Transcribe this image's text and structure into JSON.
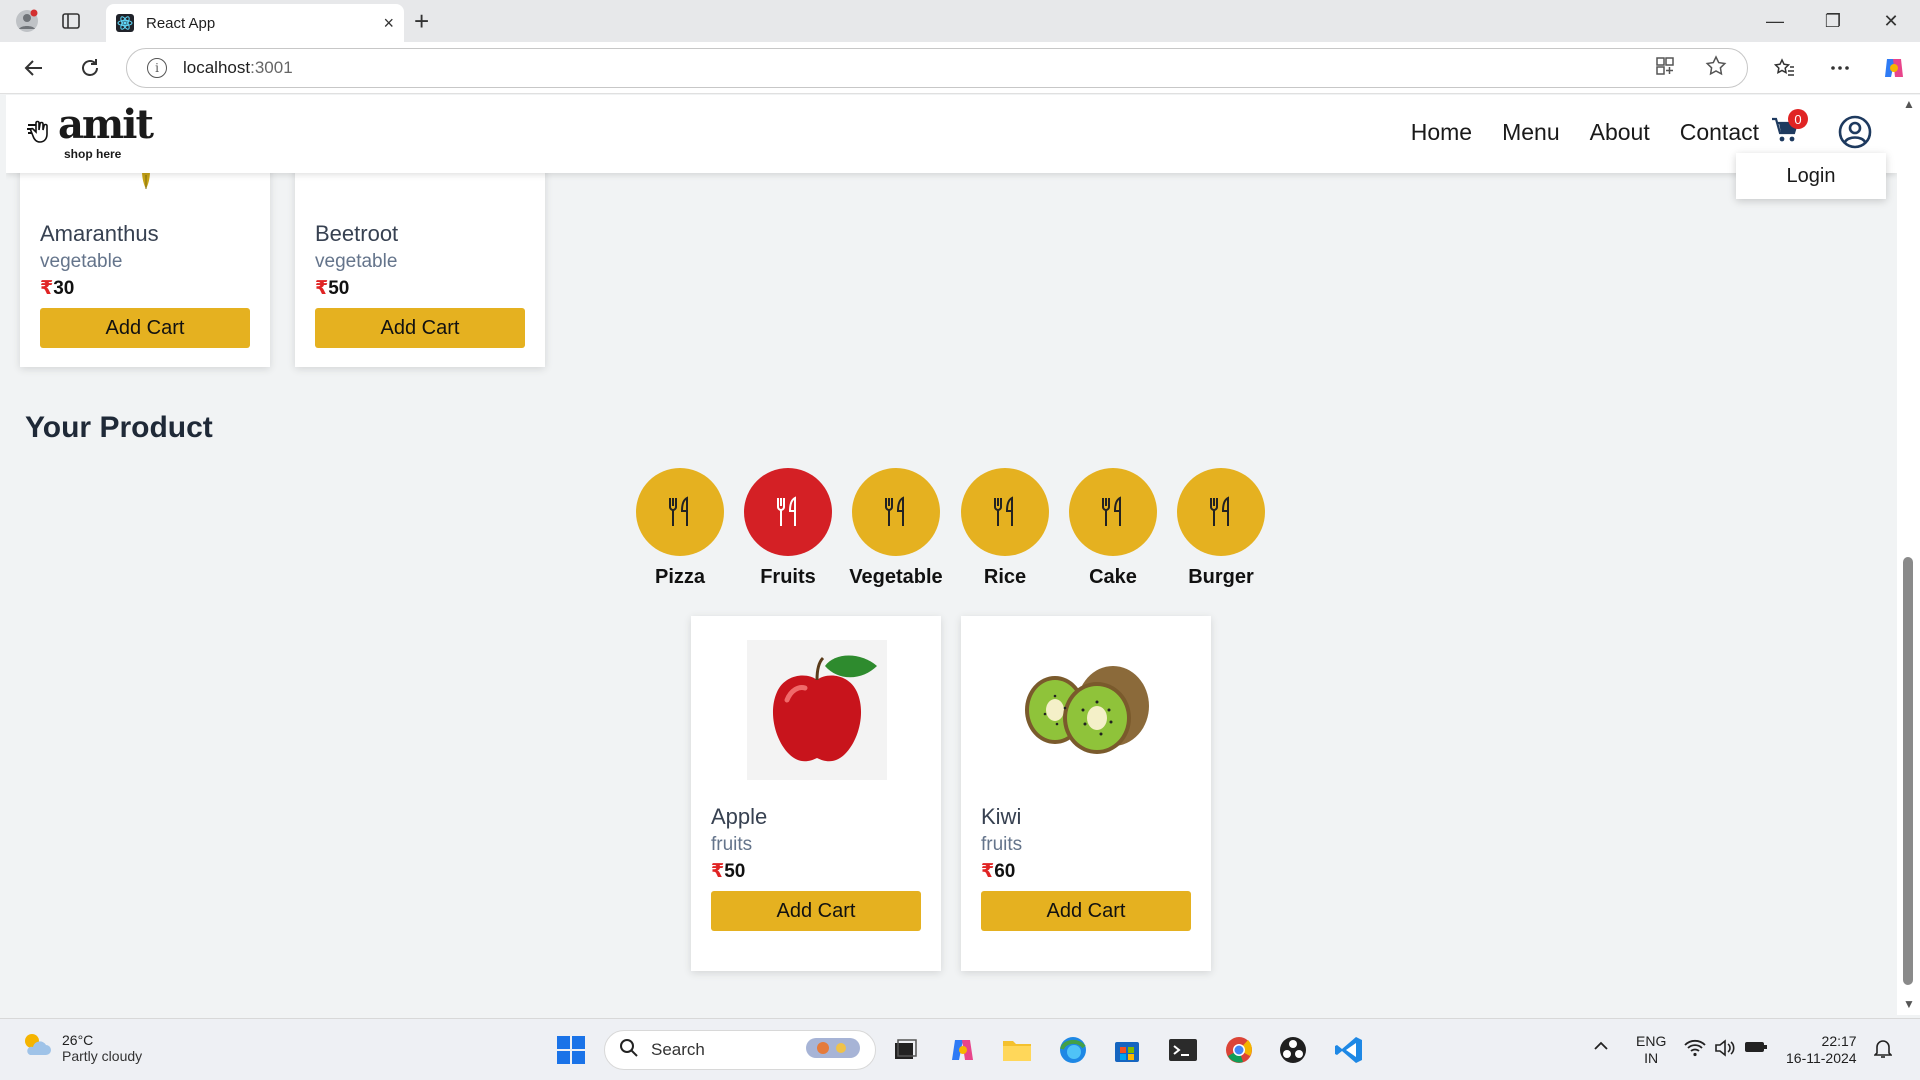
{
  "browser": {
    "tab_title": "React App",
    "close_tab": "×",
    "new_tab": "+",
    "url_host": "localhost",
    "url_port": ":3001",
    "minimize": "—",
    "restore": "❐",
    "close": "✕"
  },
  "app": {
    "logo_text": "amit",
    "logo_tagline": "shop here",
    "nav": [
      "Home",
      "Menu",
      "About",
      "Contact"
    ],
    "cart_count": "0",
    "login_label": "Login",
    "section_title": "Your Product"
  },
  "top_products": [
    {
      "name": "Amaranthus",
      "category": "vegetable",
      "currency": "₹",
      "price": "30",
      "button": "Add Cart"
    },
    {
      "name": "Beetroot",
      "category": "vegetable",
      "currency": "₹",
      "price": "50",
      "button": "Add Cart"
    }
  ],
  "categories": [
    {
      "label": "Pizza",
      "active": false
    },
    {
      "label": "Fruits",
      "active": true
    },
    {
      "label": "Vegetable",
      "active": false
    },
    {
      "label": "Rice",
      "active": false
    },
    {
      "label": "Cake",
      "active": false
    },
    {
      "label": "Burger",
      "active": false
    }
  ],
  "filtered_products": [
    {
      "name": "Apple",
      "category": "fruits",
      "currency": "₹",
      "price": "50",
      "button": "Add Cart",
      "image_icon": "apple-image"
    },
    {
      "name": "Kiwi",
      "category": "fruits",
      "currency": "₹",
      "price": "60",
      "button": "Add Cart",
      "image_icon": "kiwi-image"
    }
  ],
  "colors": {
    "accent_yellow": "#e5b120",
    "active_red": "#d42025",
    "badge_red": "#e02424"
  },
  "taskbar": {
    "temperature": "26°C",
    "weather": "Partly cloudy",
    "search_label": "Search",
    "lang_top": "ENG",
    "lang_bottom": "IN",
    "time": "22:17",
    "date": "16-11-2024"
  }
}
